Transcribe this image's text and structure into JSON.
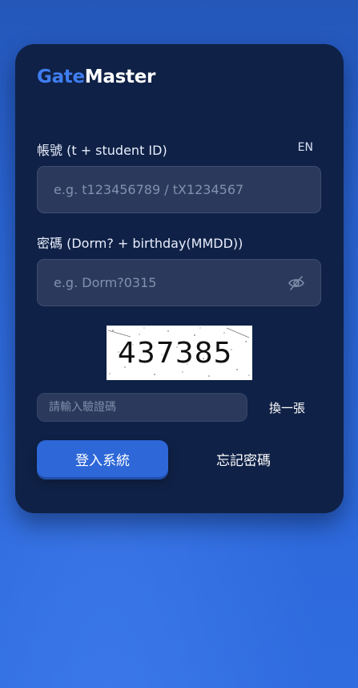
{
  "brand": {
    "part1": "Gate",
    "part2": "Master"
  },
  "language_toggle": "EN",
  "account": {
    "label": "帳號 (t + student ID)",
    "placeholder": "e.g. t123456789 / tX1234567",
    "value": ""
  },
  "password": {
    "label": "密碼 (Dorm? + birthday(MMDD))",
    "placeholder": "e.g. Dorm?0315",
    "value": ""
  },
  "captcha": {
    "code": "437385",
    "input_placeholder": "請輸入驗證碼",
    "refresh_label": "換一張"
  },
  "actions": {
    "login_label": "登入系統",
    "forgot_label": "忘記密碼"
  },
  "colors": {
    "accent": "#2d67d8",
    "brand_accent": "#3f7df0",
    "card_bg": "#0f2146",
    "field_bg": "#2b3a5c"
  },
  "icons": {
    "password_visibility": "eye-off-icon"
  }
}
